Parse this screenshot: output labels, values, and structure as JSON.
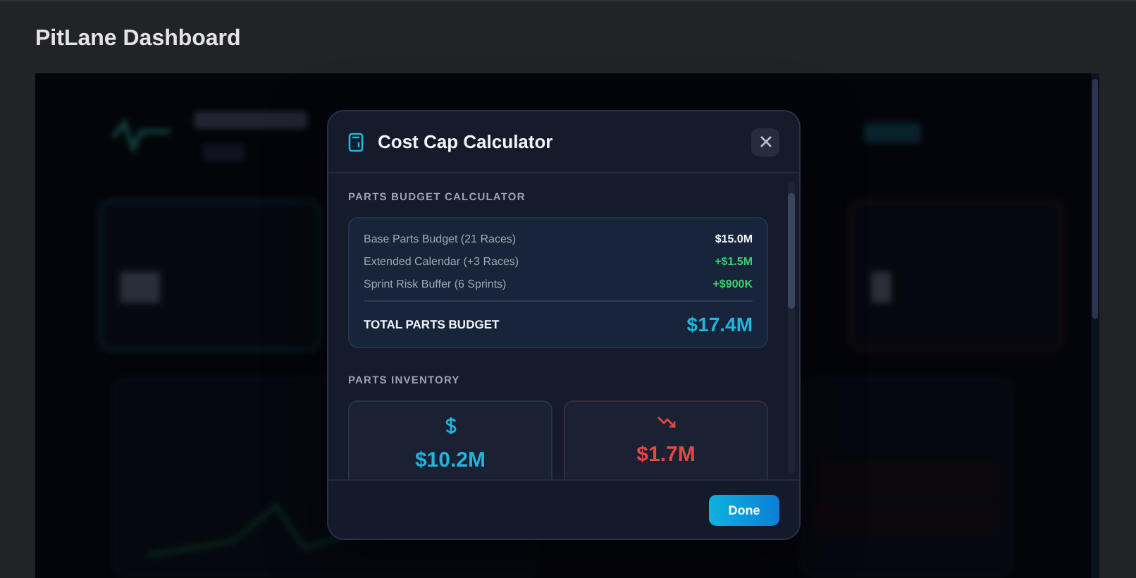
{
  "page_title": "PitLane Dashboard",
  "modal": {
    "title": "Cost Cap Calculator",
    "budget": {
      "heading": "PARTS BUDGET CALCULATOR",
      "rows": [
        {
          "label": "Base Parts Budget (21 Races)",
          "value": "$15.0M",
          "kind": "base"
        },
        {
          "label": "Extended Calendar (+3 Races)",
          "value": "+$1.5M",
          "kind": "add"
        },
        {
          "label": "Sprint Risk Buffer (6 Sprints)",
          "value": "+$900K",
          "kind": "add"
        }
      ],
      "total": {
        "label": "TOTAL PARTS BUDGET",
        "value": "$17.4M"
      }
    },
    "inventory": {
      "heading": "PARTS INVENTORY",
      "cards": [
        {
          "kind": "dollar",
          "value": "$10.2M"
        },
        {
          "kind": "loss",
          "value": "$1.7M"
        }
      ]
    },
    "done": "Done"
  }
}
